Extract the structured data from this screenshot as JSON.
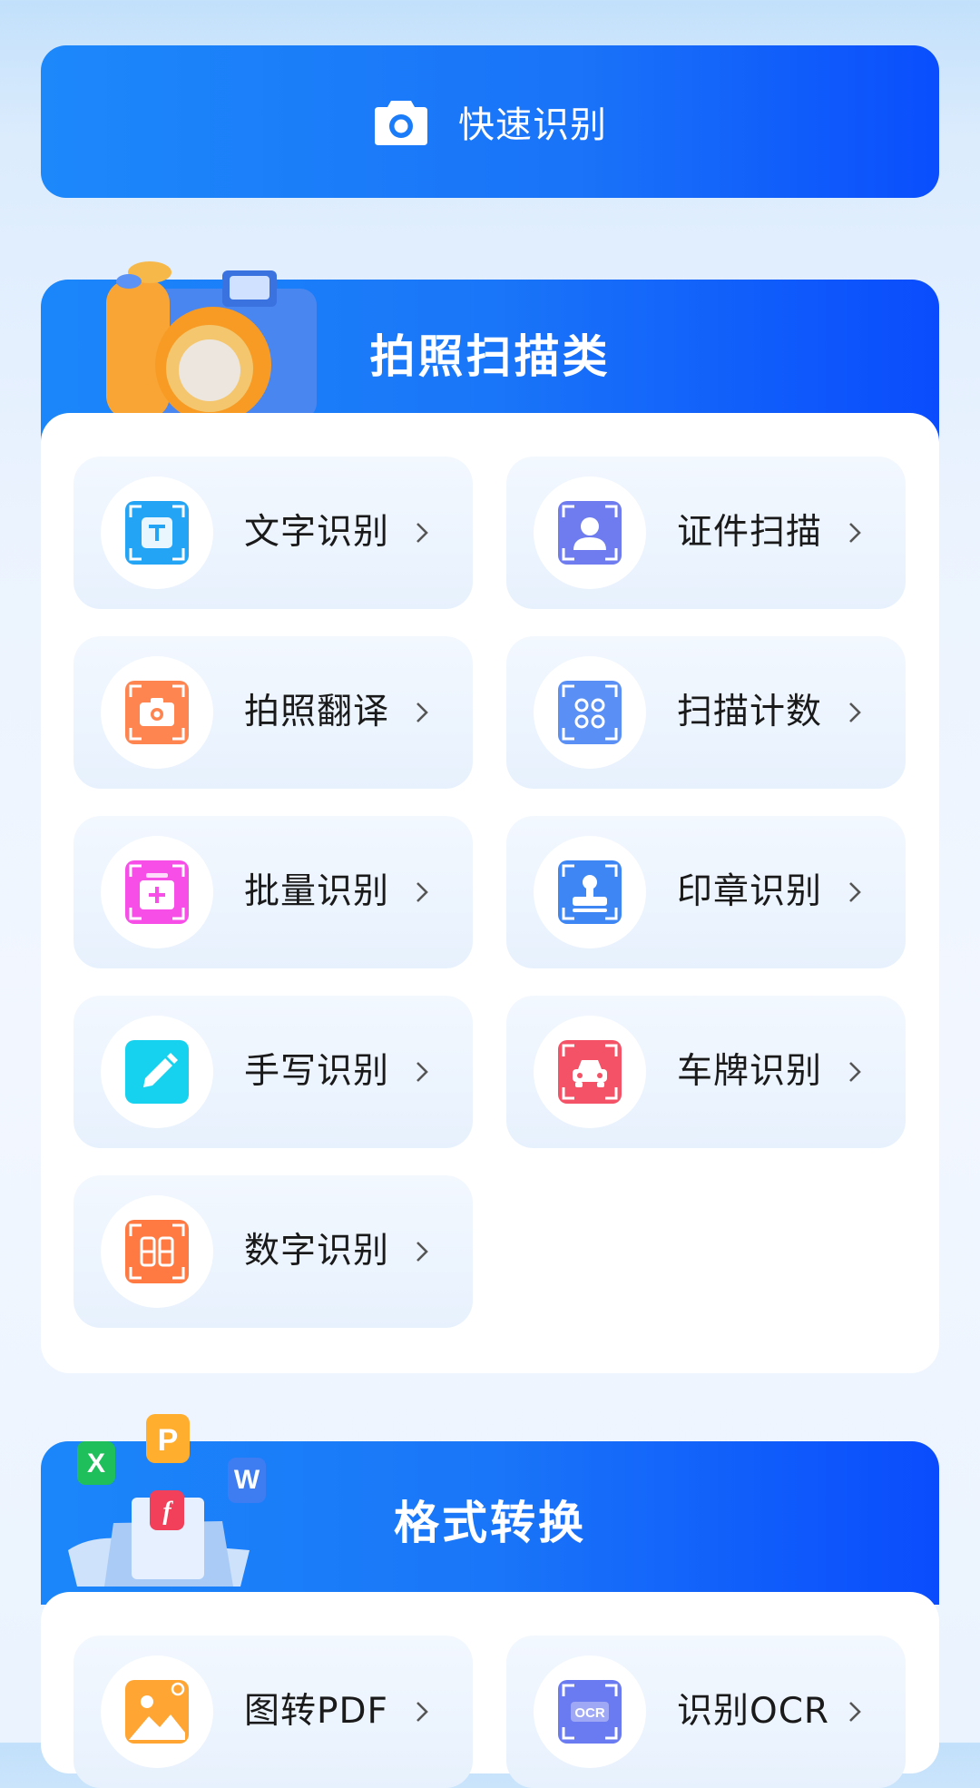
{
  "quick": {
    "label": "快速识别",
    "icon": "camera-icon"
  },
  "scan_section": {
    "title": "拍照扫描类",
    "items": [
      {
        "label": "文字识别",
        "icon": "text-scan-icon",
        "color": "#23a4f4"
      },
      {
        "label": "证件扫描",
        "icon": "id-card-icon",
        "color": "#6f7cf0"
      },
      {
        "label": "拍照翻译",
        "icon": "photo-translate-icon",
        "color": "#ff8550"
      },
      {
        "label": "扫描计数",
        "icon": "scan-count-icon",
        "color": "#5a8ff5"
      },
      {
        "label": "批量识别",
        "icon": "batch-scan-icon",
        "color": "#f74ee8"
      },
      {
        "label": "印章识别",
        "icon": "stamp-icon",
        "color": "#3d86f4"
      },
      {
        "label": "手写识别",
        "icon": "handwriting-icon",
        "color": "#17d2ee"
      },
      {
        "label": "车牌识别",
        "icon": "license-plate-icon",
        "color": "#f45266"
      },
      {
        "label": "数字识别",
        "icon": "digit-icon",
        "color": "#ff7a42"
      }
    ]
  },
  "convert_section": {
    "title": "格式转换",
    "items": [
      {
        "label": "图转PDF",
        "icon": "image-to-pdf-icon",
        "color": "#ffa533"
      },
      {
        "label": "识别OCR",
        "icon": "ocr-icon",
        "color": "#6a7af0"
      }
    ]
  },
  "decor": {
    "p": "P",
    "x": "X",
    "w": "W",
    "f": "f"
  }
}
